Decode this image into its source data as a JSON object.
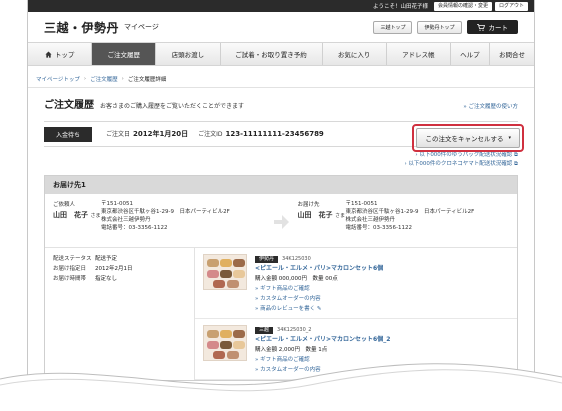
{
  "topbar": {
    "welcome": "ようこそ！山田花子様",
    "member_btn": "会員情報の確認・変更",
    "logout_btn": "ログアウト"
  },
  "header": {
    "logo": "三越・伊勢丹",
    "logo_sub": "マイページ",
    "mitsukoshi_top": "三越トップ",
    "isetan_top": "伊勢丹トップ",
    "cart": "カート"
  },
  "nav": {
    "items": [
      "トップ",
      "ご注文履歴",
      "店頭お渡し",
      "ご試着・お取り置き予約",
      "お気に入り",
      "アドレス帳",
      "ヘルプ",
      "お問合せ"
    ]
  },
  "breadcrumb": {
    "items": [
      "マイページトップ",
      "ご注文履歴",
      "ご注文履歴詳細"
    ]
  },
  "title": {
    "text": "ご注文履歴",
    "desc": "お客さまのご購入履歴をご覧いただくことができます",
    "help": "ご注文履歴の使い方"
  },
  "order": {
    "status": "入金待ち",
    "date_label": "ご注文日",
    "date": "2012年1月20日",
    "id_label": "ご注文ID",
    "id": "123-11111111-23456789",
    "cancel_btn": "この注文をキャンセルする",
    "track1": "以下000件のゆうパック配送状況確認",
    "track2": "以下000件のクロネコヤマト配送状況確認"
  },
  "shipment": {
    "header": "お届け先1",
    "requester_label": "ご依頼人",
    "requester_name": "山田　花子",
    "requester_suffix": "さま",
    "requester_zip": "〒151-0051",
    "requester_addr": "東京都渋谷区千駄ヶ谷1-29-9　日本パーティビル2F",
    "requester_company": "株式会社三越伊勢丹",
    "requester_tel": "電話番号：03-3356-1122",
    "dest_label": "お届け先",
    "dest_name": "山田　花子",
    "dest_suffix": "さま",
    "dest_zip": "〒151-0051",
    "dest_addr": "東京都渋谷区千駄ヶ谷1-29-9　日本パーティビル2F",
    "dest_company": "株式会社三越伊勢丹",
    "dest_tel": "電話番号：03-3356-1122",
    "status_label": "配送ステータス",
    "status_value": "配送予定",
    "date_label": "お届け指定日",
    "date_value": "2012年2月1日",
    "time_label": "お届け時間帯",
    "time_value": "指定なし"
  },
  "products": [
    {
      "tag": "伊勢丹",
      "code": "34K125030",
      "name": "<ピエール・エルメ・パリ>マカロンセット6個",
      "price": "購入金額 000,000円　数量 00点",
      "link1": "ギフト商品のご確認",
      "link2": "カスタムオーダーの内容",
      "link3": "商品のレビューを書く"
    },
    {
      "tag": "三越",
      "code": "34K125030_2",
      "name": "<ピエール・エルメ・パリ>マカロンセット6個_2",
      "price": "購入金額 2,000円　数量 1点",
      "link1": "ギフト商品のご確認",
      "link2": "カスタムオーダーの内容"
    }
  ],
  "colors": {
    "dark": "#2b2b2b",
    "link": "#336699",
    "highlight": "#d0303f",
    "nav_active": "#555555"
  }
}
